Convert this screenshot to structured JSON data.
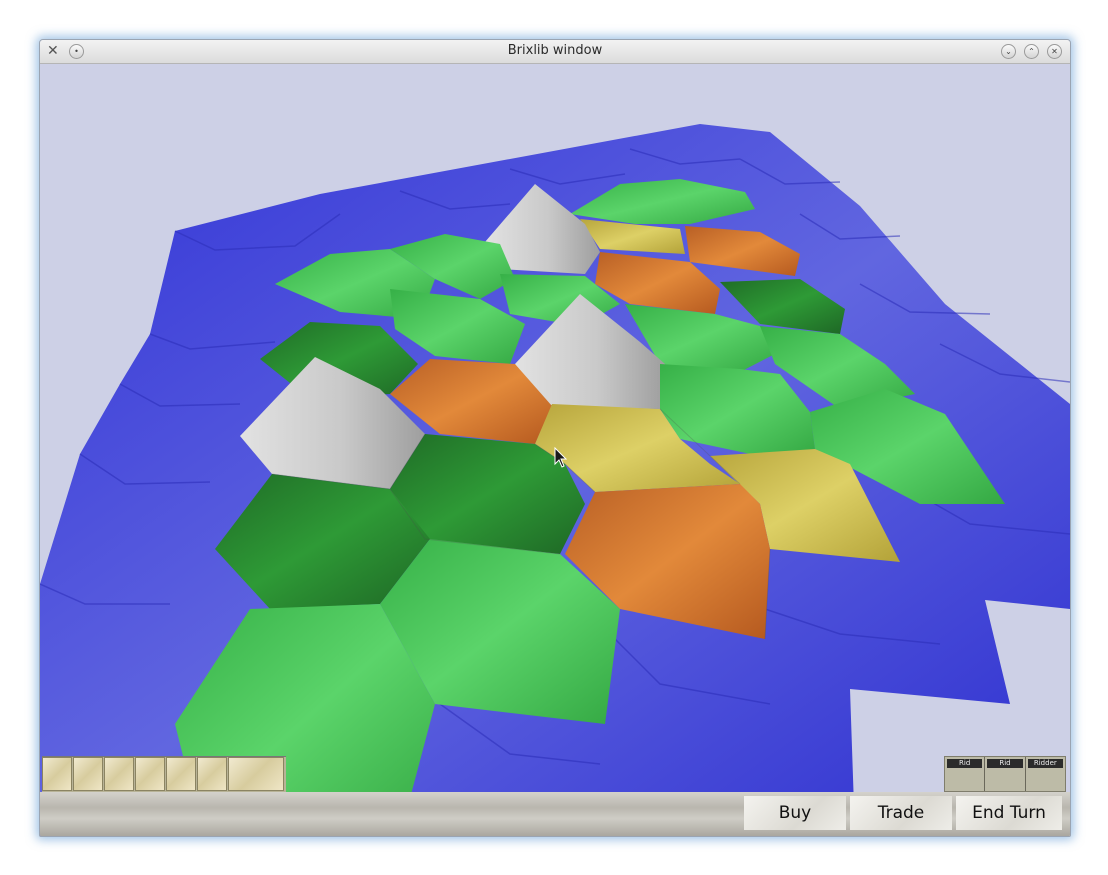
{
  "window": {
    "title": "Brixlib window",
    "controls": [
      "minimize",
      "maximize",
      "close"
    ]
  },
  "palette": {
    "sky": "#cdd0e6",
    "water": "#3c3fd9",
    "forest": "#2e8f35",
    "pasture": "#4dc85b",
    "brick": "#cd7430",
    "wheat": "#c8b84e",
    "mountain": "#c8c8c8"
  },
  "dev_cards": [
    "Rid",
    "Rid",
    "Ridder"
  ],
  "actions": {
    "buy": "Buy",
    "trade": "Trade",
    "end_turn": "End Turn"
  }
}
